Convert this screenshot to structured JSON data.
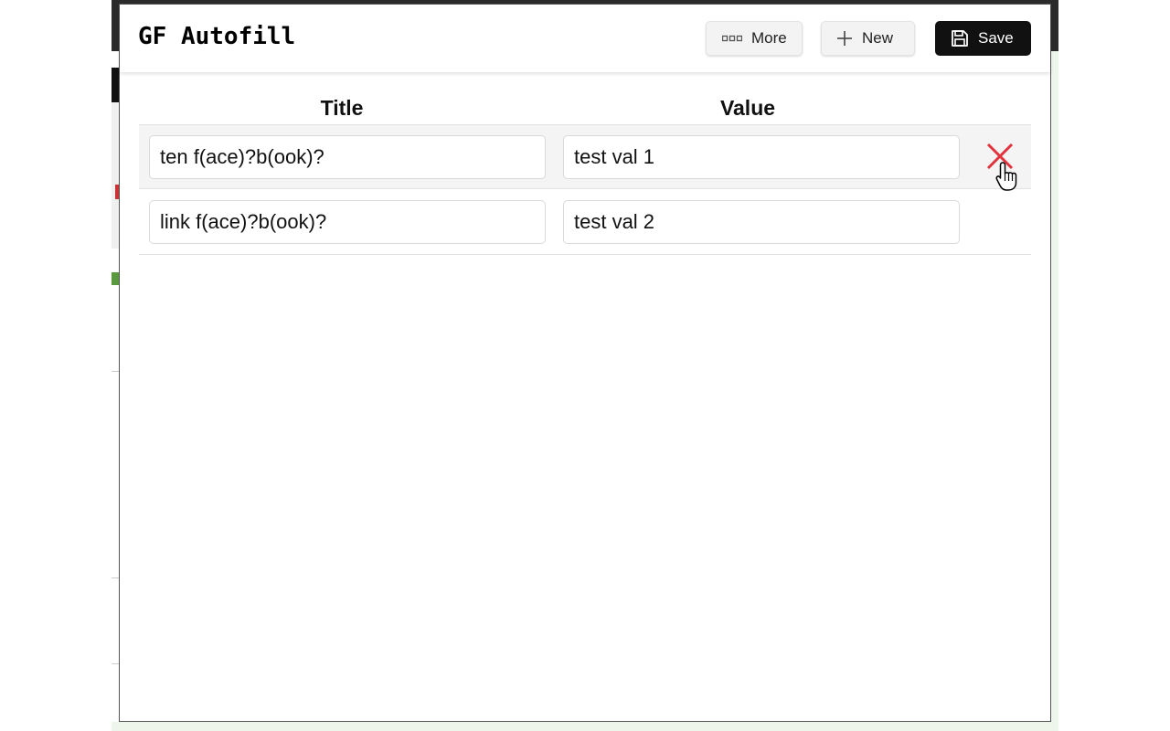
{
  "app": {
    "logo": "GF Autofill"
  },
  "toolbar": {
    "more_label": "More",
    "new_label": "New",
    "save_label": "Save"
  },
  "table": {
    "columns": {
      "title": "Title",
      "value": "Value"
    },
    "rows": [
      {
        "title": "ten f(ace)?b(ook)?",
        "value": "test val 1"
      },
      {
        "title": "link f(ace)?b(ook)?",
        "value": "test val 2"
      }
    ]
  },
  "colors": {
    "delete": "#e2323c",
    "save_bg": "#111111"
  },
  "icons": {
    "more": "dots-icon",
    "new": "plus-icon",
    "save": "floppy-disk-icon",
    "delete": "close-icon"
  }
}
